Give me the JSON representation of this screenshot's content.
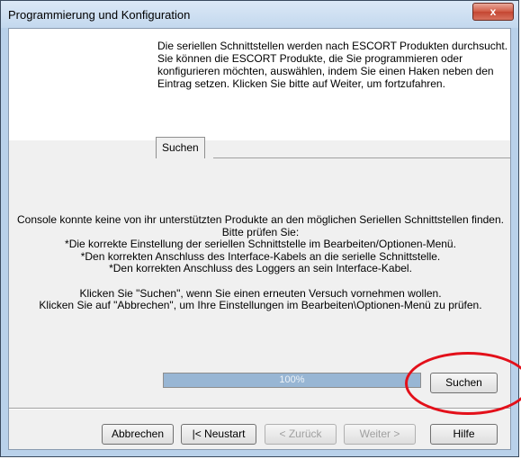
{
  "window": {
    "title": "Programmierung und Konfiguration",
    "close_glyph": "x"
  },
  "intro": {
    "line1": "Die seriellen Schnittstellen werden nach ESCORT Produkten durchsucht.",
    "line2": "Sie können die ESCORT Produkte, die Sie programmieren oder",
    "line3": "konfigurieren möchten, auswählen, indem Sie einen Haken neben den",
    "line4": "Eintrag setzen. Klicken Sie bitte auf Weiter, um fortzufahren."
  },
  "tabs": [
    {
      "label": "Suchen"
    }
  ],
  "message": {
    "lines": [
      "Console konnte keine von ihr unterstützten Produkte an den möglichen Seriellen Schnittstellen finden.",
      "Bitte prüfen Sie:",
      "*Die korrekte Einstellung der seriellen Schnittstelle im Bearbeiten/Optionen-Menü.",
      "*Den korrekten Anschluss des Interface-Kabels an die serielle Schnittstelle.",
      "*Den korrekten Anschluss des Loggers an sein Interface-Kabel.",
      "",
      "Klicken Sie \"Suchen\", wenn Sie einen erneuten Versuch vornehmen wollen.",
      "Klicken Sie auf \"Abbrechen\", um Ihre Einstellungen im Bearbeiten\\Optionen-Menü zu prüfen."
    ]
  },
  "progress": {
    "value": 1.0,
    "label": "100%"
  },
  "buttons": {
    "search": "Suchen",
    "cancel": "Abbrechen",
    "restart": "|< Neustart",
    "back": "< Zurück",
    "next": "Weiter >",
    "help": "Hilfe"
  },
  "colors": {
    "highlight_ring": "#e3101a",
    "progress_fill": "#98b6d4"
  }
}
